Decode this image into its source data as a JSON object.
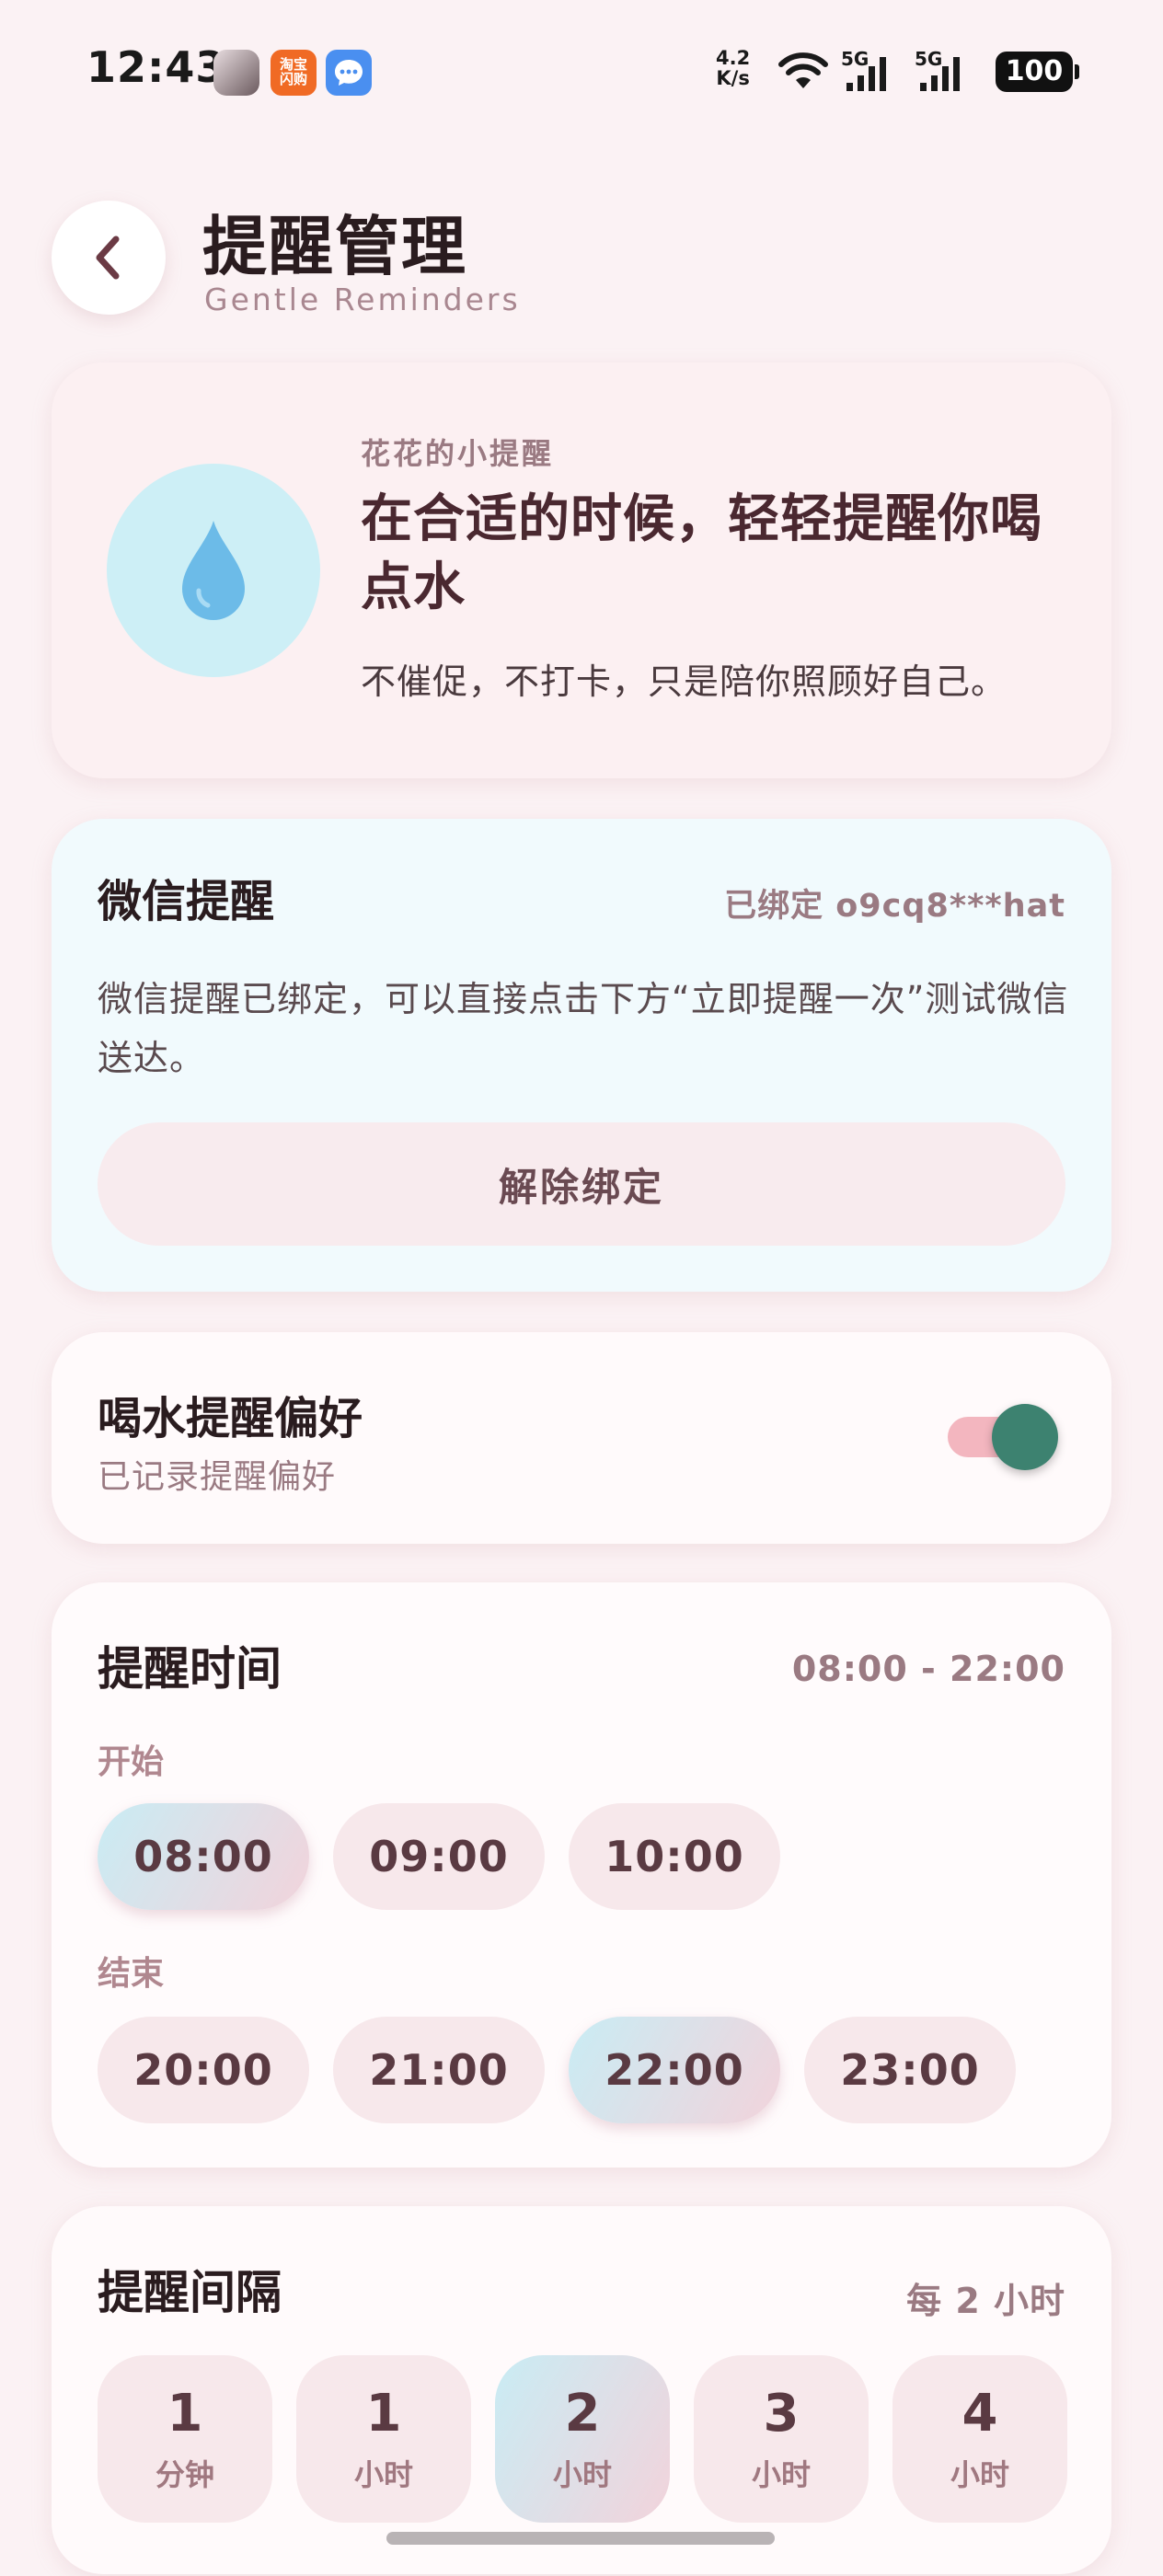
{
  "status_bar": {
    "time": "12:43",
    "app_icons": [
      "avatar-app-icon",
      "taobao-shangou-icon",
      "message-icon"
    ],
    "taobao_label": "淘宝\n闪购",
    "net_speed_value": "4.2",
    "net_speed_unit": "K/s",
    "signal1_label": "5G",
    "signal2_label": "5G",
    "battery": "100"
  },
  "header": {
    "title": "提醒管理",
    "subtitle": "Gentle Reminders"
  },
  "hero": {
    "kicker": "花花的小提醒",
    "title": "在合适的时候，轻轻提醒你喝点水",
    "description": "不催促，不打卡，只是陪你照顾好自己。",
    "icon": "water-drop-icon"
  },
  "wechat": {
    "title": "微信提醒",
    "bound_status": "已绑定 o9cq8***hat",
    "description": "微信提醒已绑定，可以直接点击下方“立即提醒一次”测试微信送达。",
    "unbind_label": "解除绑定"
  },
  "preference": {
    "title": "喝水提醒偏好",
    "subtitle": "已记录提醒偏好",
    "enabled": true
  },
  "reminder_time": {
    "title": "提醒时间",
    "range": "08:00 - 22:00",
    "start_label": "开始",
    "start_options": [
      "08:00",
      "09:00",
      "10:00"
    ],
    "start_selected": "08:00",
    "end_label": "结束",
    "end_options": [
      "20:00",
      "21:00",
      "22:00",
      "23:00"
    ],
    "end_selected": "22:00"
  },
  "interval": {
    "title": "提醒间隔",
    "summary": "每 2 小时",
    "options": [
      {
        "num": "1",
        "unit": "分钟"
      },
      {
        "num": "1",
        "unit": "小时"
      },
      {
        "num": "2",
        "unit": "小时"
      },
      {
        "num": "3",
        "unit": "小时"
      },
      {
        "num": "4",
        "unit": "小时"
      }
    ],
    "selected_index": 2
  },
  "colors": {
    "background": "#fbf2f4",
    "accent_teal": "#3d8270",
    "toggle_track": "#f3b6bf",
    "selected_chip_gradient_from": "#c9ecf4",
    "selected_chip_gradient_to": "#f2d3db"
  }
}
